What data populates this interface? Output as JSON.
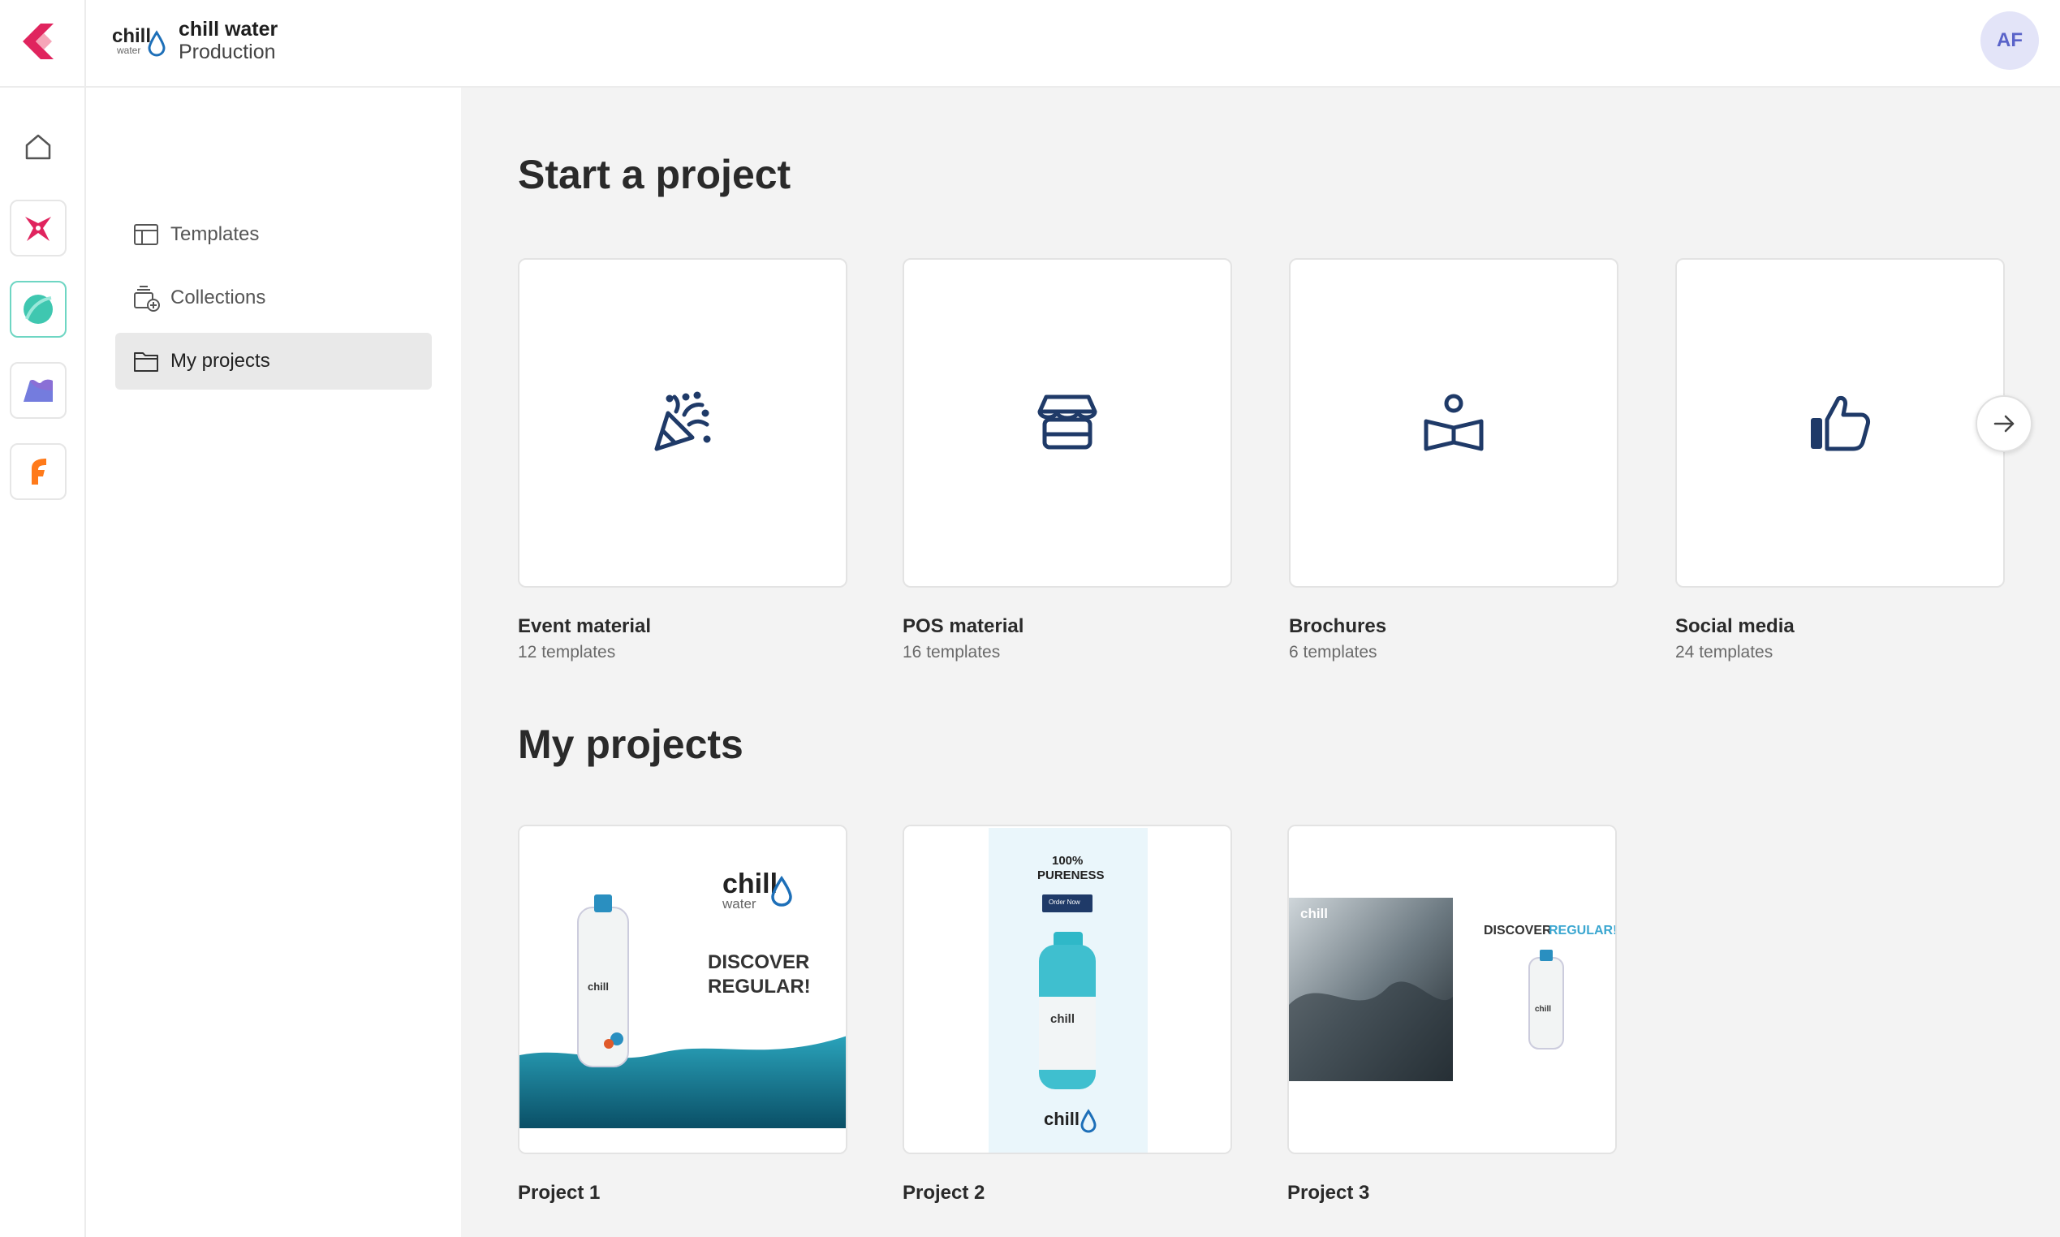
{
  "header": {
    "brand_name": "chill water",
    "brand_sub": "Production",
    "avatar_initials": "AF"
  },
  "rail": {
    "items": [
      "home-icon",
      "star-app-icon",
      "leaf-app-icon",
      "wave-app-icon",
      "f-app-icon"
    ]
  },
  "subnav": {
    "items": [
      {
        "label": "Templates",
        "icon": "layout-icon"
      },
      {
        "label": "Collections",
        "icon": "collections-add-icon"
      },
      {
        "label": "My projects",
        "icon": "folder-icon",
        "active": true
      }
    ]
  },
  "start": {
    "title": "Start a project",
    "categories": [
      {
        "label": "Event material",
        "count": "12 templates",
        "icon": "party-popper-icon"
      },
      {
        "label": "POS material",
        "count": "16 templates",
        "icon": "storefront-icon"
      },
      {
        "label": "Brochures",
        "count": "6 templates",
        "icon": "reader-book-icon"
      },
      {
        "label": "Social media",
        "count": "24 templates",
        "icon": "thumbs-up-icon"
      }
    ]
  },
  "projects": {
    "title": "My projects",
    "items": [
      {
        "label": "Project 1"
      },
      {
        "label": "Project 2"
      },
      {
        "label": "Project 3"
      }
    ]
  },
  "thumbnails": {
    "p1_brand": "chill",
    "p1_brand_sub": "water",
    "p1_headline_1": "DISCOVER",
    "p1_headline_2": "REGULAR!",
    "p2_headline_1": "100%",
    "p2_headline_2": "PURENESS",
    "p2_button": "Order Now",
    "p2_brand": "chill",
    "p3_headline_a": "DISCOVER",
    "p3_headline_b": "REGULAR!",
    "p3_brand": "chill"
  },
  "colors": {
    "icon_navy": "#1f3a68",
    "accent_red": "#e0245e",
    "accent_teal": "#3fc7b0",
    "avatar_bg": "#e3e4f8"
  }
}
